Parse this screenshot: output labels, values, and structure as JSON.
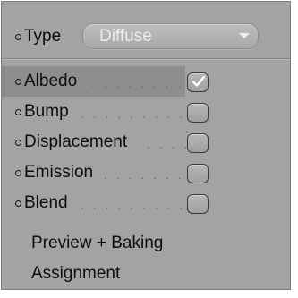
{
  "type_row": {
    "label": "Type",
    "dropdown_value": "Diffuse"
  },
  "channels": [
    {
      "label": "Albedo",
      "leader": ". . . . . . . .",
      "checked": true,
      "selected": true
    },
    {
      "label": "Bump",
      "leader": ". . . . . . . . .",
      "checked": false,
      "selected": false
    },
    {
      "label": "Displacement",
      "leader": ". . . .",
      "checked": false,
      "selected": false
    },
    {
      "label": "Emission",
      "leader": ". . . . . . .",
      "checked": false,
      "selected": false
    },
    {
      "label": "Blend",
      "leader": ". . . . . . . . .",
      "checked": false,
      "selected": false
    }
  ],
  "links": {
    "preview_baking": "Preview + Baking",
    "assignment": "Assignment"
  },
  "colors": {
    "panel_bg": "#a3a3a3",
    "selected_row_bg": "#8e8e8e",
    "dropdown_text": "#ececec"
  }
}
